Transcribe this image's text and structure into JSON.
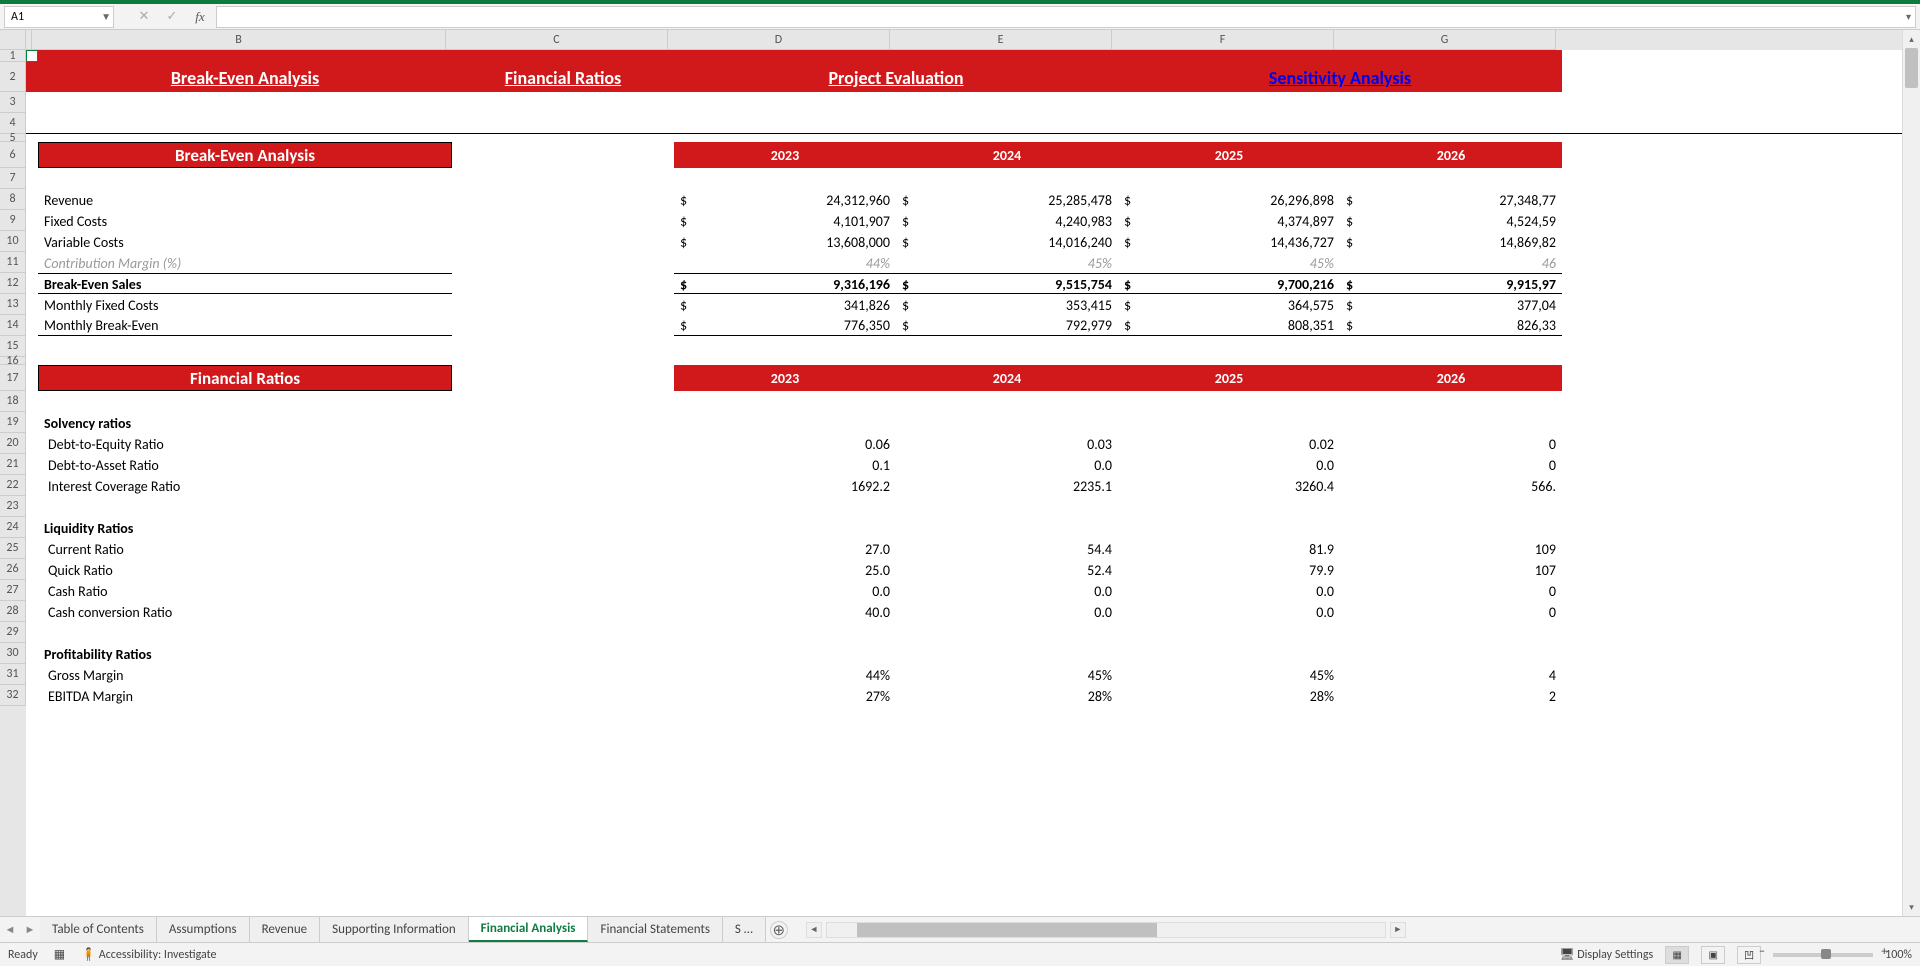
{
  "cell_ref": "A1",
  "nav_links": {
    "break_even": "Break-Even Analysis",
    "financial_ratios": "Financial Ratios",
    "project_eval": "Project Evaluation",
    "sensitivity": "Sensitivity Analysis"
  },
  "sections": {
    "break_even": "Break-Even Analysis",
    "financial_ratios": "Financial Ratios"
  },
  "years": [
    "2023",
    "2024",
    "2025",
    "2026"
  ],
  "break_even_rows": [
    {
      "label": "Revenue",
      "vals": [
        "24,312,960",
        "25,285,478",
        "26,296,898",
        "27,348,77"
      ]
    },
    {
      "label": "Fixed Costs",
      "vals": [
        "4,101,907",
        "4,240,983",
        "4,374,897",
        "4,524,59"
      ]
    },
    {
      "label": "Variable Costs",
      "vals": [
        "13,608,000",
        "14,016,240",
        "14,436,727",
        "14,869,82"
      ]
    },
    {
      "label": "Contribution Margin (%)",
      "italic": true,
      "percent": true,
      "vals": [
        "44%",
        "45%",
        "45%",
        "46"
      ]
    },
    {
      "label": "Break-Even Sales",
      "bold": true,
      "border": true,
      "vals": [
        "9,316,196",
        "9,515,754",
        "9,700,216",
        "9,915,97"
      ]
    },
    {
      "label": "Monthly Fixed Costs",
      "vals": [
        "341,826",
        "353,415",
        "364,575",
        "377,04"
      ]
    },
    {
      "label": "Monthly Break-Even",
      "border_bottom": true,
      "vals": [
        "776,350",
        "792,979",
        "808,351",
        "826,33"
      ]
    }
  ],
  "ratio_groups": [
    {
      "title": "Solvency ratios",
      "rows": [
        {
          "label": "Debt-to-Equity Ratio",
          "vals": [
            "0.06",
            "0.03",
            "0.02",
            "0"
          ]
        },
        {
          "label": "Debt-to-Asset Ratio",
          "vals": [
            "0.1",
            "0.0",
            "0.0",
            "0"
          ]
        },
        {
          "label": "Interest Coverage Ratio",
          "vals": [
            "1692.2",
            "2235.1",
            "3260.4",
            "566."
          ]
        }
      ]
    },
    {
      "title": "Liquidity Ratios",
      "rows": [
        {
          "label": "Current Ratio",
          "vals": [
            "27.0",
            "54.4",
            "81.9",
            "109"
          ]
        },
        {
          "label": "Quick Ratio",
          "vals": [
            "25.0",
            "52.4",
            "79.9",
            "107"
          ]
        },
        {
          "label": "Cash Ratio",
          "vals": [
            "0.0",
            "0.0",
            "0.0",
            "0"
          ]
        },
        {
          "label": "Cash conversion Ratio",
          "vals": [
            "40.0",
            "0.0",
            "0.0",
            "0"
          ]
        }
      ]
    },
    {
      "title": "Profitability Ratios",
      "rows": [
        {
          "label": "Gross Margin",
          "vals": [
            "44%",
            "45%",
            "45%",
            "4"
          ]
        },
        {
          "label": "EBITDA Margin",
          "vals": [
            "27%",
            "28%",
            "28%",
            "2"
          ]
        }
      ]
    }
  ],
  "columns": [
    "B",
    "C",
    "D",
    "E",
    "F",
    "G"
  ],
  "row_numbers": [
    "1",
    "2",
    "3",
    "4",
    "5",
    "6",
    "7",
    "8",
    "9",
    "10",
    "11",
    "12",
    "13",
    "14",
    "15",
    "16",
    "17",
    "18",
    "19",
    "20",
    "21",
    "22",
    "23",
    "24",
    "25",
    "26",
    "27",
    "28",
    "29",
    "30",
    "31",
    "32"
  ],
  "tabs": [
    "Table of Contents",
    "Assumptions",
    "Revenue",
    "Supporting Information",
    "Financial Analysis",
    "Financial Statements",
    "S …"
  ],
  "active_tab": "Financial Analysis",
  "status": {
    "ready": "Ready",
    "accessibility": "Accessibility: Investigate",
    "display": "Display Settings",
    "zoom": "100%"
  }
}
